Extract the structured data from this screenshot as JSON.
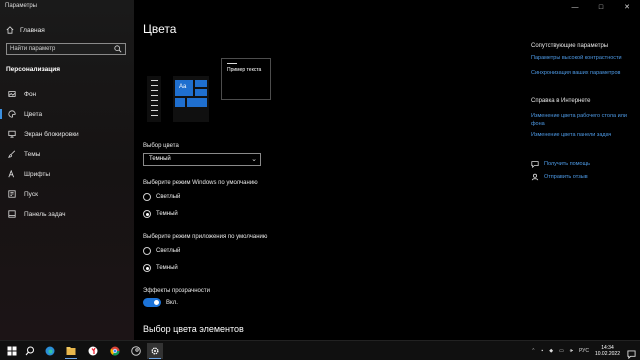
{
  "window": {
    "title": "Параметры",
    "minimize": "—",
    "maximize": "□",
    "close": "✕"
  },
  "sidebar": {
    "home_label": "Главная",
    "search_placeholder": "Найти параметр",
    "section_title": "Персонализация",
    "items": [
      {
        "label": "Фон",
        "icon": "image-icon"
      },
      {
        "label": "Цвета",
        "icon": "palette-icon",
        "active": true
      },
      {
        "label": "Экран блокировки",
        "icon": "monitor-icon"
      },
      {
        "label": "Темы",
        "icon": "brush-icon"
      },
      {
        "label": "Шрифты",
        "icon": "font-icon"
      },
      {
        "label": "Пуск",
        "icon": "start-icon"
      },
      {
        "label": "Панель задач",
        "icon": "taskbar-icon"
      }
    ]
  },
  "main": {
    "title": "Цвета",
    "preview": {
      "tile_text": "Aa",
      "sample_text": "Пример текста"
    },
    "color_choice_label": "Выбор цвета",
    "color_choice_value": "Темный",
    "windows_mode": {
      "label": "Выберите режим Windows по умолчанию",
      "options": [
        "Светлый",
        "Темный"
      ],
      "selected": "Темный"
    },
    "app_mode": {
      "label": "Выберите режим приложения по умолчанию",
      "options": [
        "Светлый",
        "Темный"
      ],
      "selected": "Темный"
    },
    "transparency": {
      "label": "Эффекты прозрачности",
      "state": "Вкл.",
      "on": true
    },
    "accent_heading": "Выбор цвета элементов",
    "accent_color": "#1c73d8"
  },
  "right_panel": {
    "related_title": "Сопутствующие параметры",
    "related_links": [
      "Параметры высокой контрастности",
      "Синхронизация ваших параметров"
    ],
    "help_title": "Справка в Интернете",
    "help_links": [
      "Изменение цвета рабочего стола или фона",
      "Изменение цвета панели задач"
    ],
    "get_help": "Получить помощь",
    "feedback": "Отправить отзыв",
    "link_color": "#4d9ae6"
  },
  "taskbar": {
    "icons": [
      "windows-start-icon",
      "search-icon",
      "edge-icon",
      "explorer-icon",
      "yandex-icon",
      "chrome-icon",
      "steam-icon",
      "settings-icon"
    ],
    "language": "РУС",
    "time": "14:34",
    "date": "10.02.2022"
  }
}
